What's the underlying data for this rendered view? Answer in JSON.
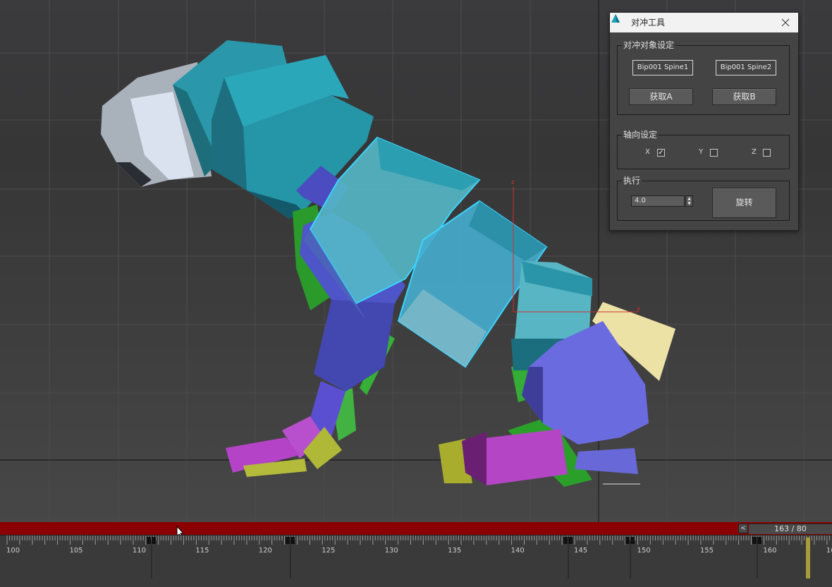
{
  "tool_window": {
    "title": "对冲工具",
    "groups": {
      "target": {
        "title": "对冲对象设定",
        "object_a": "Bip001 Spine1",
        "object_b": "Bip001 Spine2",
        "pick_a_label": "获取A",
        "pick_b_label": "获取B"
      },
      "axis": {
        "title": "轴向设定",
        "x_label": "X",
        "x_checked": true,
        "y_label": "Y",
        "y_checked": false,
        "z_label": "Z",
        "z_checked": false
      },
      "execute": {
        "title": "执行",
        "value": "4.0",
        "rotate_label": "旋转"
      }
    }
  },
  "viewport": {
    "gizmo_z_label": "z",
    "gizmo_y_label": "y"
  },
  "timeline": {
    "frame_counter": "163 / 80",
    "prev_label": "<",
    "ticks": [
      "100",
      "105",
      "110",
      "115",
      "120",
      "125",
      "130",
      "135",
      "140",
      "145",
      "150",
      "155",
      "160",
      "16"
    ],
    "slider_color": "#8b0101"
  },
  "icons": {
    "app": "3dsmax-icon",
    "close": "close-icon",
    "cursor": "mouse-cursor-icon"
  }
}
